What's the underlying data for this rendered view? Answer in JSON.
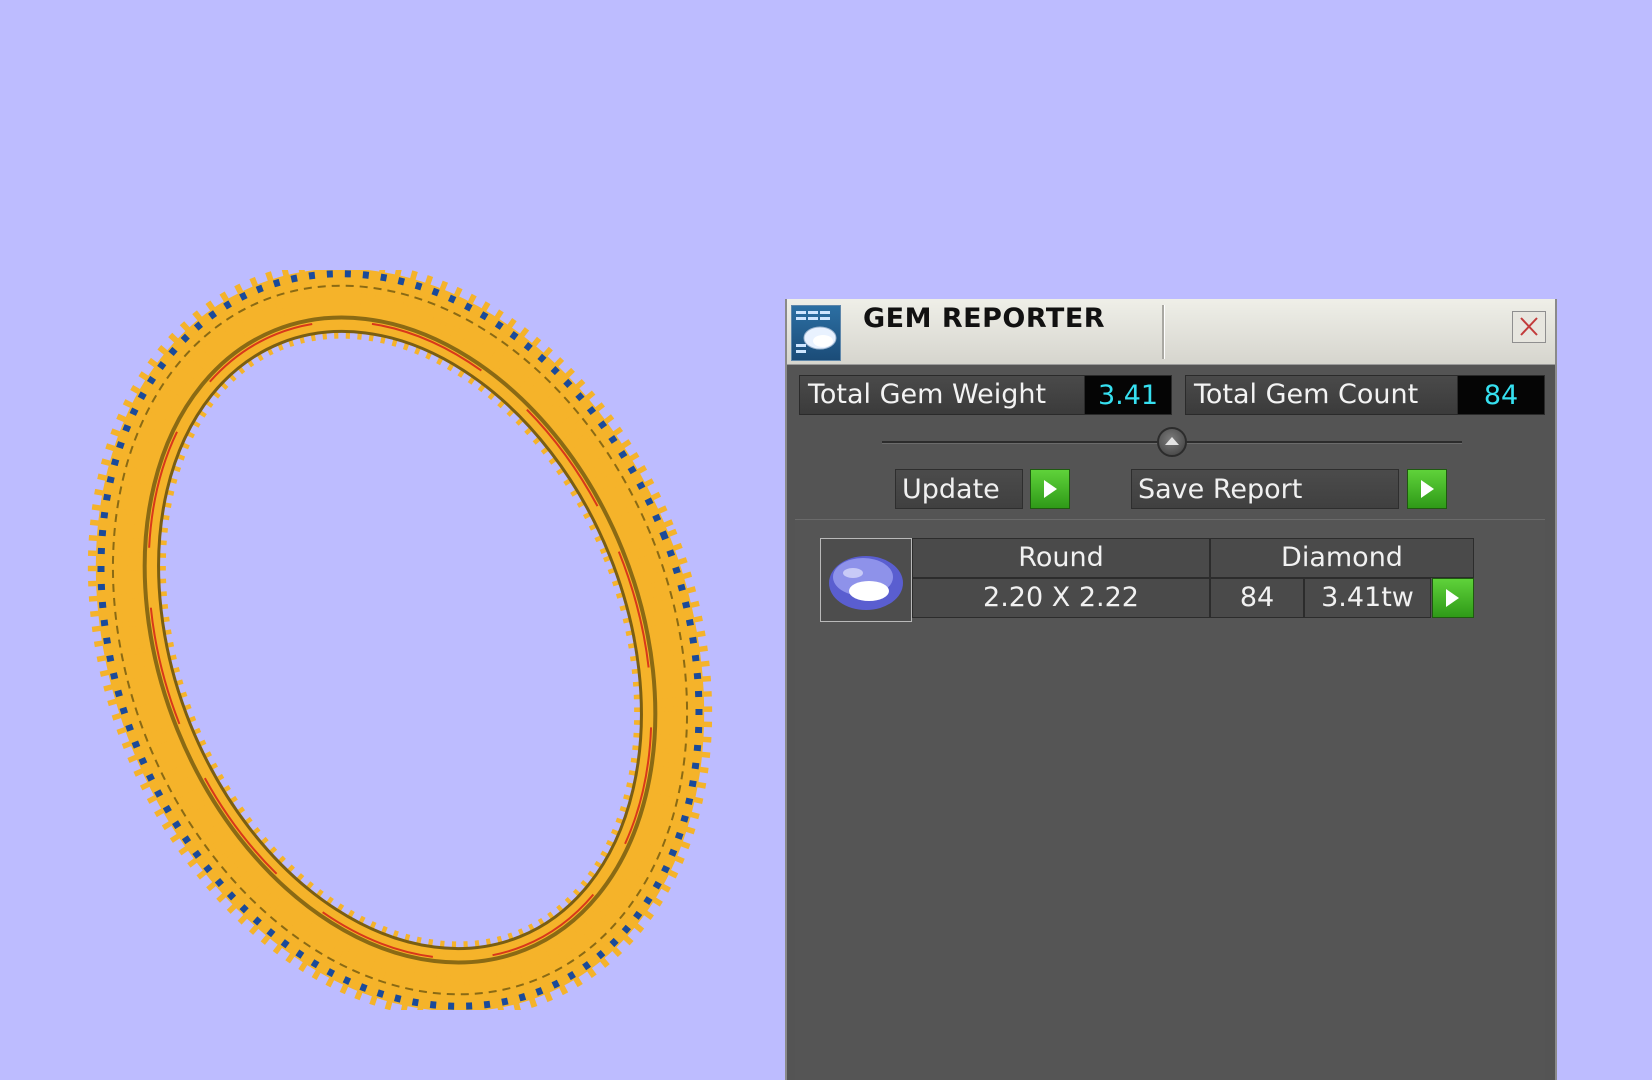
{
  "panel": {
    "title": "GEM REPORTER",
    "total_weight_label": "Total Gem Weight",
    "total_weight_value": "3.41",
    "total_count_label": "Total Gem Count",
    "total_count_value": "84",
    "update_label": "Update",
    "save_report_label": "Save Report",
    "icons": [
      "app-icon",
      "close-icon",
      "collapse-icon",
      "play-icon",
      "gem-icon"
    ]
  },
  "gems": [
    {
      "shape": "Round",
      "material": "Diamond",
      "size": "2.20 X 2.22",
      "count": "84",
      "weight": "3.41tw"
    }
  ],
  "colors": {
    "viewport_bg": "#bdbcff",
    "ring_gold": "#f5b32a",
    "ring_inner": "#8a6a14",
    "gem_blue": "#1a4a9a",
    "value_cyan": "#36e0f0",
    "go_green": "#3fb21f"
  }
}
